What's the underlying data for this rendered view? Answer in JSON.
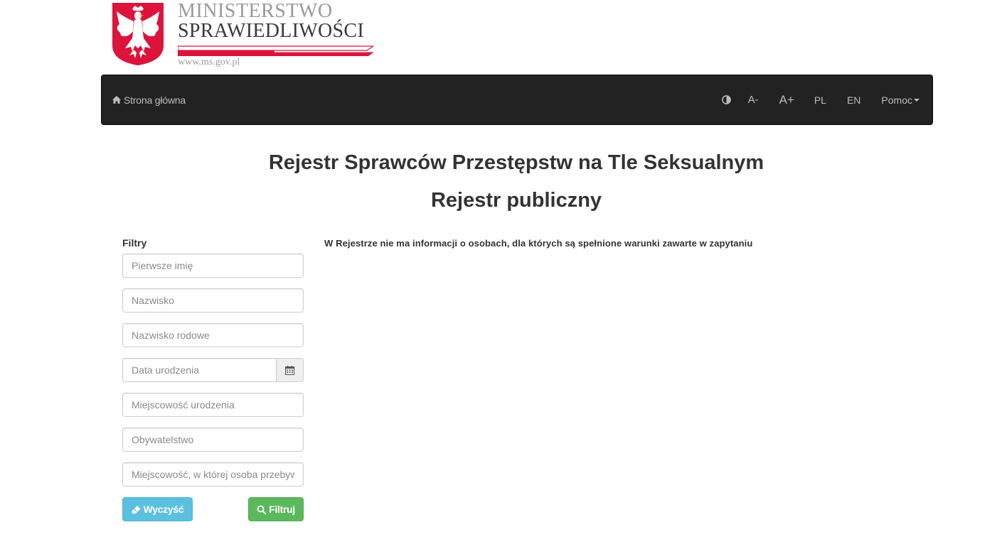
{
  "logo": {
    "line1": "MINISTERSTWO",
    "line2": "SPRAWIEDLIWOŚCI",
    "url": "www.ms.gov.pl"
  },
  "navbar": {
    "home_label": "Strona główna",
    "font_decrease": "A-",
    "font_increase": "A+",
    "lang_pl": "PL",
    "lang_en": "EN",
    "help": "Pomoc"
  },
  "titles": {
    "main": "Rejestr Sprawców Przestępstw na Tle Seksualnym",
    "sub": "Rejestr publiczny"
  },
  "filters": {
    "label": "Filtry",
    "first_name": {
      "placeholder": "Pierwsze imię",
      "value": ""
    },
    "surname": {
      "placeholder": "Nazwisko",
      "value": ""
    },
    "family_name": {
      "placeholder": "Nazwisko rodowe",
      "value": ""
    },
    "birth_date": {
      "placeholder": "Data urodzenia",
      "value": ""
    },
    "birth_place": {
      "placeholder": "Miejscowość urodzenia",
      "value": ""
    },
    "citizenship": {
      "placeholder": "Obywatelstwo",
      "value": ""
    },
    "residence_place": {
      "placeholder": "Miejscowość, w której osoba przebywa",
      "value": ""
    },
    "clear_label": "Wyczyść",
    "filter_label": "Filtruj"
  },
  "message": "W Rejestrze nie ma informacji o osobach, dla których są spełnione warunki zawarte w zapytaniu",
  "colors": {
    "navbar_bg": "#222222",
    "nav_text": "#bdbdbd",
    "btn_info": "#5bc0de",
    "btn_success": "#5cb85c",
    "flag_red": "#dc143c",
    "link": "#337ab7"
  },
  "icons": {
    "home": "home-icon",
    "contrast": "contrast-icon",
    "calendar": "calendar-icon",
    "eraser": "eraser-icon",
    "search": "search-icon",
    "emblem": "polish-eagle-emblem"
  }
}
